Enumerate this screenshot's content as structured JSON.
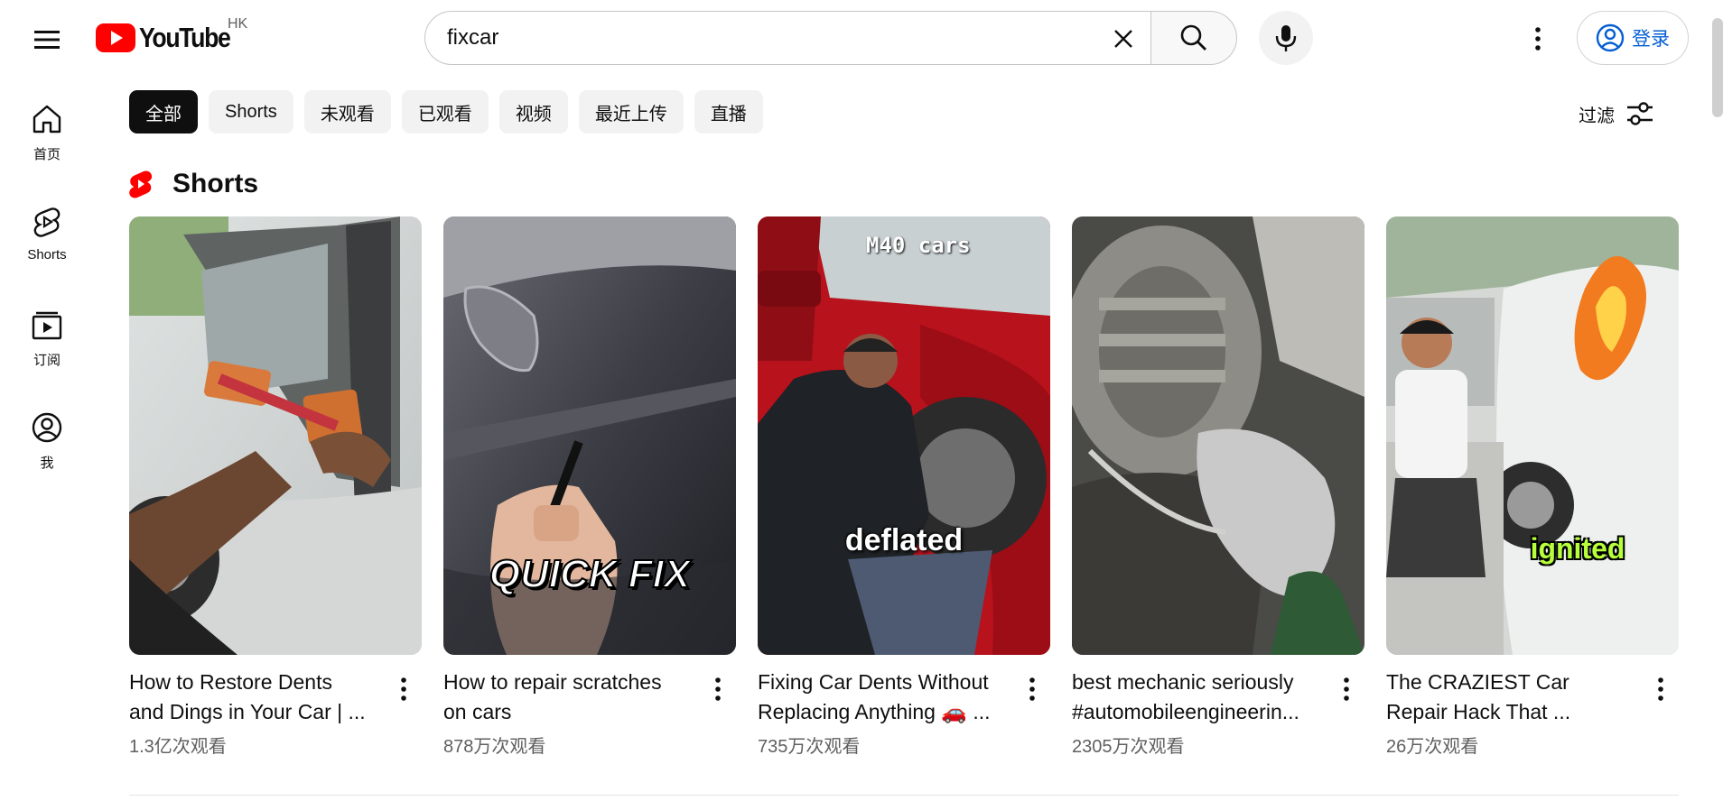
{
  "header": {
    "logo_text": "YouTube",
    "region": "HK",
    "search_value": "fixcar",
    "signin_label": "登录"
  },
  "sidenav": {
    "items": [
      {
        "label": "首页",
        "icon": "home-icon"
      },
      {
        "label": "Shorts",
        "icon": "shorts-icon"
      },
      {
        "label": "订阅",
        "icon": "subscriptions-icon"
      },
      {
        "label": "我",
        "icon": "account-icon"
      }
    ]
  },
  "chips": [
    "全部",
    "Shorts",
    "未观看",
    "已观看",
    "视频",
    "最近上传",
    "直播"
  ],
  "filter_label": "过滤",
  "shelf": {
    "title": "Shorts",
    "items": [
      {
        "title_line1": "How to Restore Dents",
        "title_line2": "and Dings in Your Car | ...",
        "views": "1.3亿次观看",
        "overlay": ""
      },
      {
        "title_line1": "How to repair scratches",
        "title_line2": "on cars",
        "views": "878万次观看",
        "overlay": "QUICK FIX"
      },
      {
        "title_line1": "Fixing Car Dents Without",
        "title_line2": "Replacing Anything 🚗 ...",
        "views": "735万次观看",
        "overlay": "deflated",
        "overlay_top": "M40 cars"
      },
      {
        "title_line1": "best mechanic seriously",
        "title_line2": "#automobileengineerin...",
        "views": "2305万次观看",
        "overlay": ""
      },
      {
        "title_line1": "The CRAZIEST Car",
        "title_line2": "Repair Hack That ...",
        "views": "26万次观看",
        "overlay": "ignited"
      }
    ]
  },
  "colors": {
    "youtube_red": "#ff0000",
    "link_blue": "#065fd4",
    "active_chip": "#0f0f0f",
    "chip_bg": "#f2f2f2"
  }
}
